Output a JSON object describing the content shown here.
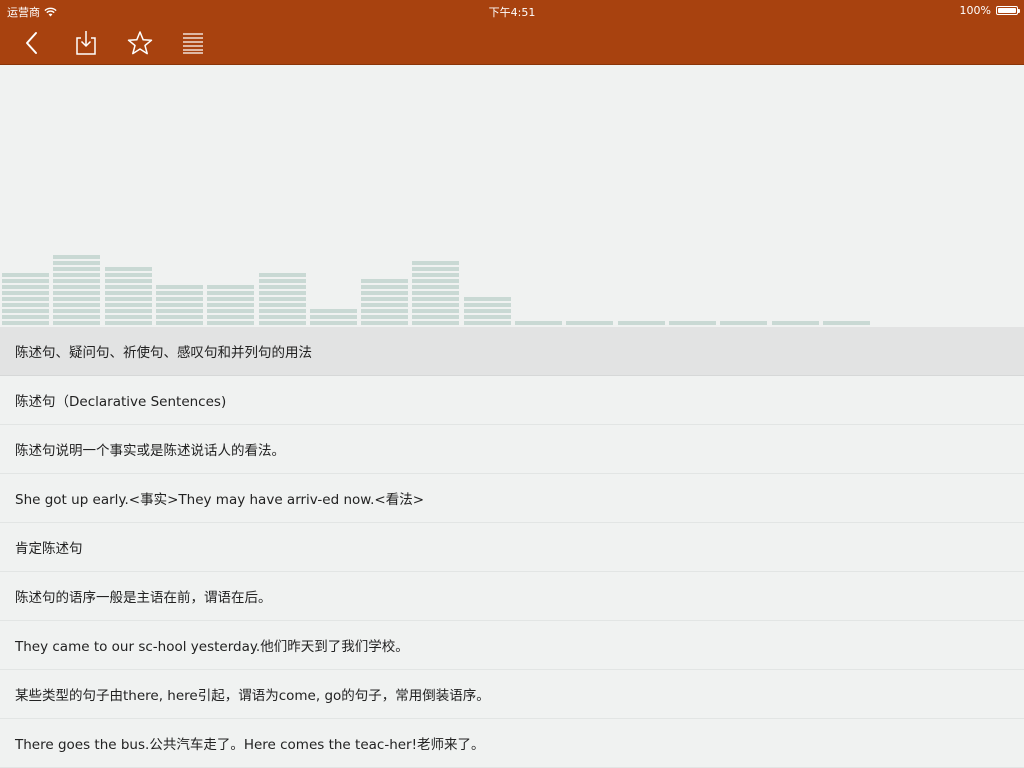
{
  "status_bar": {
    "carrier": "运营商",
    "time": "下午4:51",
    "battery": "100%",
    "battery_level": 1.0
  },
  "toolbar": {
    "buttons": [
      "back-icon",
      "download-icon",
      "star-icon",
      "list-icon"
    ]
  },
  "visualizer": {
    "levels": [
      9,
      12,
      10,
      7,
      7,
      9,
      3,
      8,
      11,
      5,
      1,
      1,
      1,
      1,
      1,
      1,
      1
    ]
  },
  "sentences": [
    "陈述句、疑问句、祈使句、感叹句和并列句的用法",
    "陈述句（Declarative Sentences)",
    "陈述句说明一个事实或是陈述说话人的看法。",
    "She got up early.<事实>They may have arriv-ed now.<看法>",
    "肯定陈述句",
    "陈述句的语序一般是主语在前，谓语在后。",
    "They came to our sc-hool yesterday.他们昨天到了我们学校。",
    "某些类型的句子由there, here引起，谓语为come, go的句子，常用倒装语序。",
    "There goes the bus.公共汽车走了。Here comes the teac-her!老师来了。"
  ],
  "selected_index": 0,
  "colors": {
    "toolbar": "#a8420f",
    "background": "#f0f2f1",
    "bars": "#c9d9d4",
    "selected_row": "#e2e3e3"
  }
}
